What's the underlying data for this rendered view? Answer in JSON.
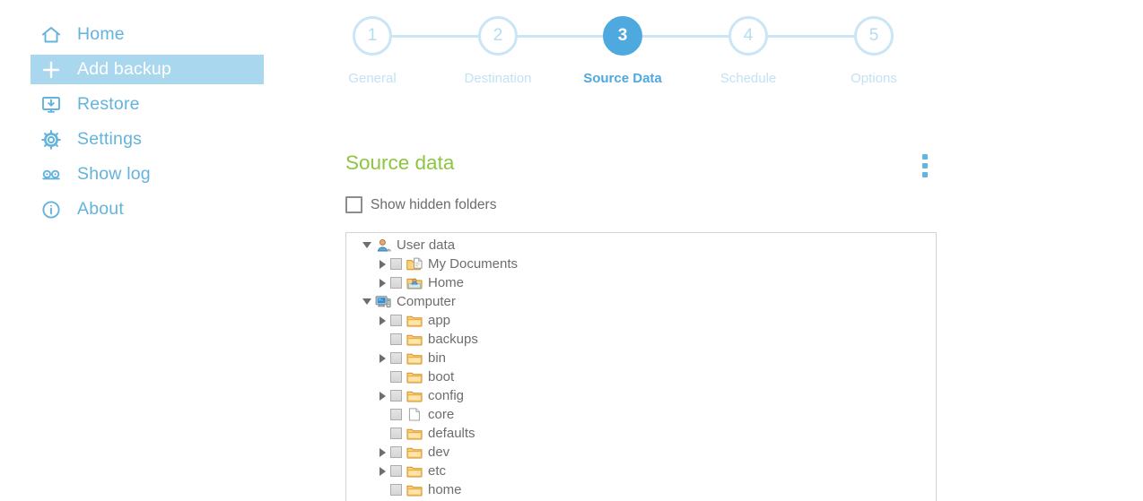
{
  "sidebar": {
    "items": [
      {
        "label": "Home",
        "icon": "home-icon",
        "active": false
      },
      {
        "label": "Add backup",
        "icon": "plus-icon",
        "active": true
      },
      {
        "label": "Restore",
        "icon": "restore-icon",
        "active": false
      },
      {
        "label": "Settings",
        "icon": "gear-icon",
        "active": false
      },
      {
        "label": "Show log",
        "icon": "log-icon",
        "active": false
      },
      {
        "label": "About",
        "icon": "info-icon",
        "active": false
      }
    ]
  },
  "stepper": {
    "current_step": 3,
    "steps": [
      {
        "number": "1",
        "label": "General"
      },
      {
        "number": "2",
        "label": "Destination"
      },
      {
        "number": "3",
        "label": "Source Data"
      },
      {
        "number": "4",
        "label": "Schedule"
      },
      {
        "number": "5",
        "label": "Options"
      }
    ]
  },
  "main": {
    "section_title": "Source data",
    "section_title_color": "#8cc63f",
    "overflow_menu": "kebab-menu",
    "show_hidden": {
      "label": "Show hidden folders",
      "checked": false
    }
  },
  "tree": {
    "rows": [
      {
        "name": "User data",
        "depth": 0,
        "twisty": "open",
        "checkbox": false,
        "icon": "user-icon"
      },
      {
        "name": "My Documents",
        "depth": 1,
        "twisty": "closed",
        "checkbox": true,
        "icon": "documents-icon"
      },
      {
        "name": "Home",
        "depth": 1,
        "twisty": "closed",
        "checkbox": true,
        "icon": "home-folder-icon"
      },
      {
        "name": "Computer",
        "depth": 0,
        "twisty": "open",
        "checkbox": false,
        "icon": "computer-icon"
      },
      {
        "name": "app",
        "depth": 1,
        "twisty": "closed",
        "checkbox": true,
        "icon": "folder-icon"
      },
      {
        "name": "backups",
        "depth": 1,
        "twisty": "none",
        "checkbox": true,
        "icon": "folder-icon"
      },
      {
        "name": "bin",
        "depth": 1,
        "twisty": "closed",
        "checkbox": true,
        "icon": "folder-icon"
      },
      {
        "name": "boot",
        "depth": 1,
        "twisty": "none",
        "checkbox": true,
        "icon": "folder-icon"
      },
      {
        "name": "config",
        "depth": 1,
        "twisty": "closed",
        "checkbox": true,
        "icon": "folder-icon"
      },
      {
        "name": "core",
        "depth": 1,
        "twisty": "none",
        "checkbox": true,
        "icon": "file-icon"
      },
      {
        "name": "defaults",
        "depth": 1,
        "twisty": "none",
        "checkbox": true,
        "icon": "folder-icon"
      },
      {
        "name": "dev",
        "depth": 1,
        "twisty": "closed",
        "checkbox": true,
        "icon": "folder-icon"
      },
      {
        "name": "etc",
        "depth": 1,
        "twisty": "closed",
        "checkbox": true,
        "icon": "folder-icon"
      },
      {
        "name": "home",
        "depth": 1,
        "twisty": "none",
        "checkbox": true,
        "icon": "folder-icon"
      }
    ]
  },
  "colors": {
    "accent_blue": "#64b3dd",
    "active_nav_bg": "#a9d7ee",
    "step_active": "#4ea9de",
    "step_inactive": "#c9e5f6",
    "green": "#8cc63f"
  }
}
